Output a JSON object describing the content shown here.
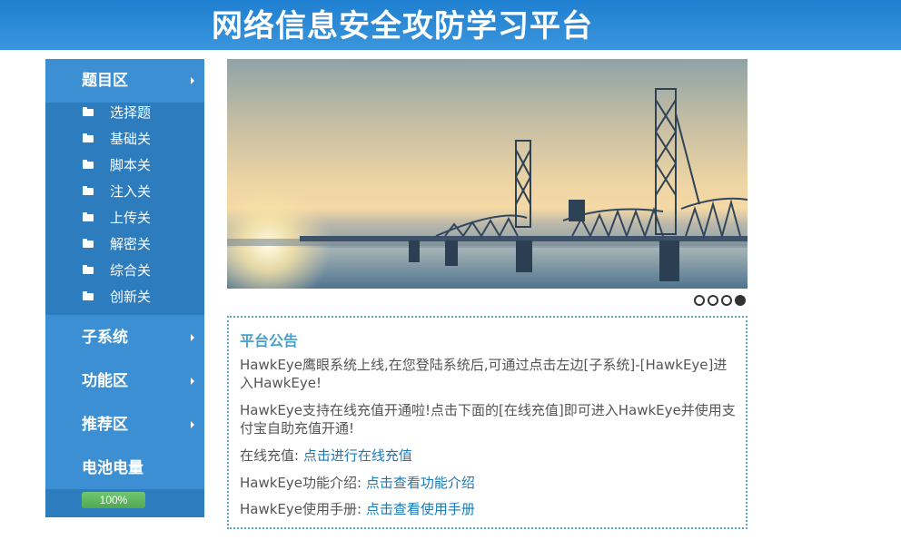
{
  "header": {
    "title": "网络信息安全攻防学习平台"
  },
  "sidebar": {
    "sections": [
      {
        "label": "题目区"
      },
      {
        "label": "子系统"
      },
      {
        "label": "功能区"
      },
      {
        "label": "推荐区"
      },
      {
        "label": "电池电量"
      }
    ],
    "sub_items": [
      {
        "label": "选择题"
      },
      {
        "label": "基础关"
      },
      {
        "label": "脚本关"
      },
      {
        "label": "注入关"
      },
      {
        "label": "上传关"
      },
      {
        "label": "解密关"
      },
      {
        "label": "综合关"
      },
      {
        "label": "创新关"
      }
    ],
    "battery": {
      "text": "100%",
      "percent": 100
    }
  },
  "carousel": {
    "slide_count": 4,
    "active_index": 3
  },
  "notice": {
    "title": "平台公告",
    "p1": "HawkEye鹰眼系统上线,在您登陆系统后,可通过点击左边[子系统]-[HawkEye]进入HawkEye!",
    "p2": "HawkEye支持在线充值开通啦!点击下面的[在线充值]即可进入HawkEye并使用支付宝自助充值开通!",
    "recharge_label": "在线充值: ",
    "recharge_link": "点击进行在线充值",
    "intro_label": "HawkEye功能介绍: ",
    "intro_link": "点击查看功能介绍",
    "manual_label": "HawkEye使用手册: ",
    "manual_link": "点击查看使用手册"
  },
  "colors": {
    "header": "#1f7fd0",
    "sidebar": "#3b8fd2",
    "submenu": "#2d7cbd",
    "battery": "#5cb85c",
    "notice_border": "#55aacc",
    "link": "#1a7ab8"
  },
  "icons": {
    "folder": "folder-icon",
    "arrow": "caret-right-icon"
  }
}
